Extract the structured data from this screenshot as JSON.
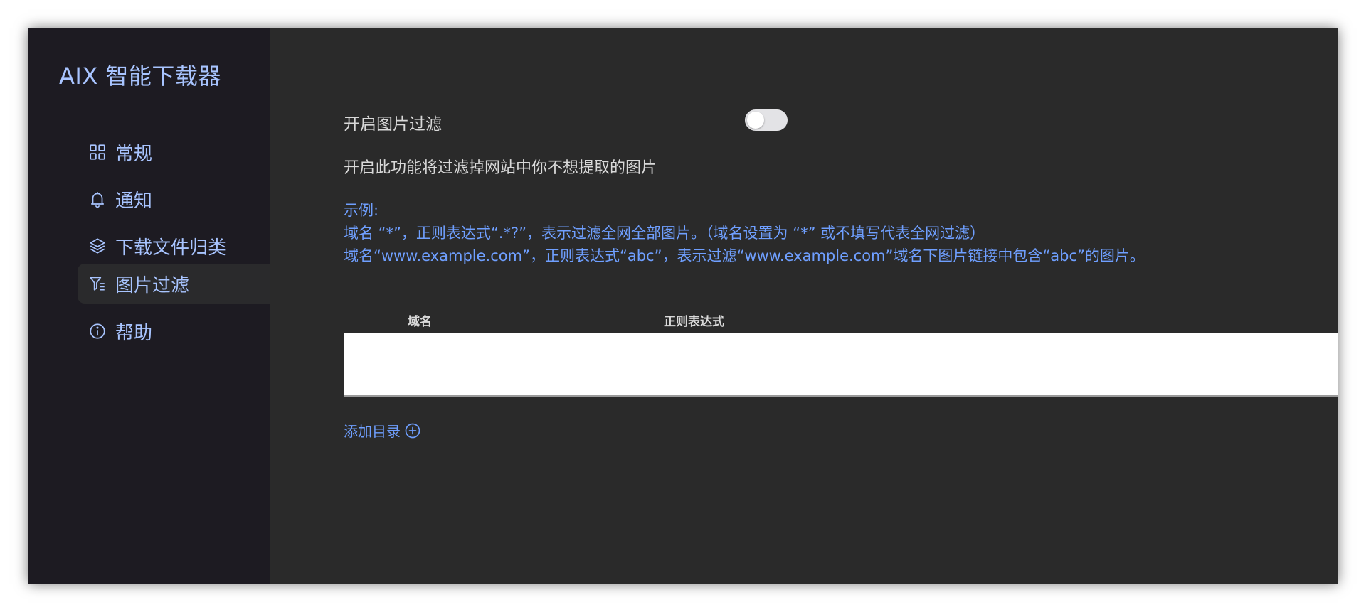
{
  "app": {
    "title": "AIX 智能下载器"
  },
  "sidebar": {
    "items": [
      {
        "label": "常规",
        "icon": "grid-icon"
      },
      {
        "label": "通知",
        "icon": "bell-icon"
      },
      {
        "label": "下载文件归类",
        "icon": "layers-icon"
      },
      {
        "label": "图片过滤",
        "icon": "filter-icon",
        "active": true
      },
      {
        "label": "帮助",
        "icon": "info-icon"
      }
    ]
  },
  "main": {
    "toggle_label": "开启图片过滤",
    "toggle_on": false,
    "description": "开启此功能将过滤掉网站中你不想提取的图片",
    "example": {
      "title": "示例:",
      "line1": "域名 “*”，正则表达式“.*?”，表示过滤全网全部图片。（域名设置为 “*” 或不填写代表全网过滤）",
      "line2": "域名“www.example.com”，正则表达式“abc”，表示过滤“www.example.com”域名下图片链接中包含“abc”的图片。"
    },
    "table": {
      "columns": [
        "域名",
        "正则表达式"
      ],
      "rows": []
    },
    "add_label": "添加目录"
  },
  "colors": {
    "accent": "#a8c4ff",
    "link": "#6f9fff",
    "sidebar_bg": "#1d1b22",
    "main_bg": "#2a2a2a"
  }
}
